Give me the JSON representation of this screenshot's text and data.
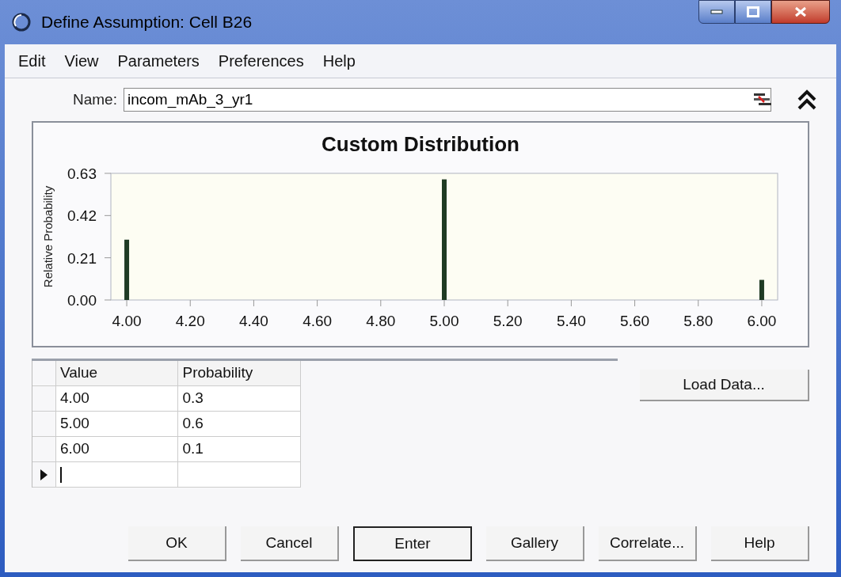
{
  "window": {
    "title": "Define Assumption: Cell B26"
  },
  "menu": [
    "Edit",
    "View",
    "Parameters",
    "Preferences",
    "Help"
  ],
  "name_field": {
    "label": "Name:",
    "value": "incom_mAb_3_yr1"
  },
  "chart_data": {
    "type": "bar",
    "title": "Custom Distribution",
    "ylabel": "Relative Probability",
    "x": [
      4,
      5,
      6
    ],
    "series": [
      {
        "color": "#1f3b24",
        "values": [
          0.3,
          0.6,
          0.1
        ]
      }
    ],
    "xlim": [
      3.95,
      6.05
    ],
    "ylim": [
      0,
      0.63
    ],
    "xticks": [
      {
        "value": 4,
        "label": "4.00"
      },
      {
        "value": 4.2,
        "label": "4.20"
      },
      {
        "value": 4.4,
        "label": "4.40"
      },
      {
        "value": 4.6,
        "label": "4.60"
      },
      {
        "value": 4.8,
        "label": "4.80"
      },
      {
        "value": 5,
        "label": "5.00"
      },
      {
        "value": 5.2,
        "label": "5.20"
      },
      {
        "value": 5.4,
        "label": "5.40"
      },
      {
        "value": 5.6,
        "label": "5.60"
      },
      {
        "value": 5.8,
        "label": "5.80"
      },
      {
        "value": 6,
        "label": "6.00"
      }
    ],
    "yticks": [
      {
        "value": 0,
        "label": "0.00"
      },
      {
        "value": 0.21,
        "label": "0.21"
      },
      {
        "value": 0.42,
        "label": "0.42"
      },
      {
        "value": 0.63,
        "label": "0.63"
      }
    ]
  },
  "table": {
    "columns": [
      "Value",
      "Probability"
    ],
    "rows": [
      {
        "cells": [
          "4.00",
          "0.3"
        ],
        "current": false
      },
      {
        "cells": [
          "5.00",
          "0.6"
        ],
        "current": false
      },
      {
        "cells": [
          "6.00",
          "0.1"
        ],
        "current": false
      },
      {
        "cells": [],
        "current": true
      }
    ]
  },
  "side_button": "Load Data...",
  "buttons": [
    {
      "label": "OK",
      "default": false
    },
    {
      "label": "Cancel",
      "default": false
    },
    {
      "label": "Enter",
      "default": true
    },
    {
      "label": "Gallery",
      "default": false
    },
    {
      "label": "Correlate...",
      "default": false
    },
    {
      "label": "Help",
      "default": false
    }
  ]
}
